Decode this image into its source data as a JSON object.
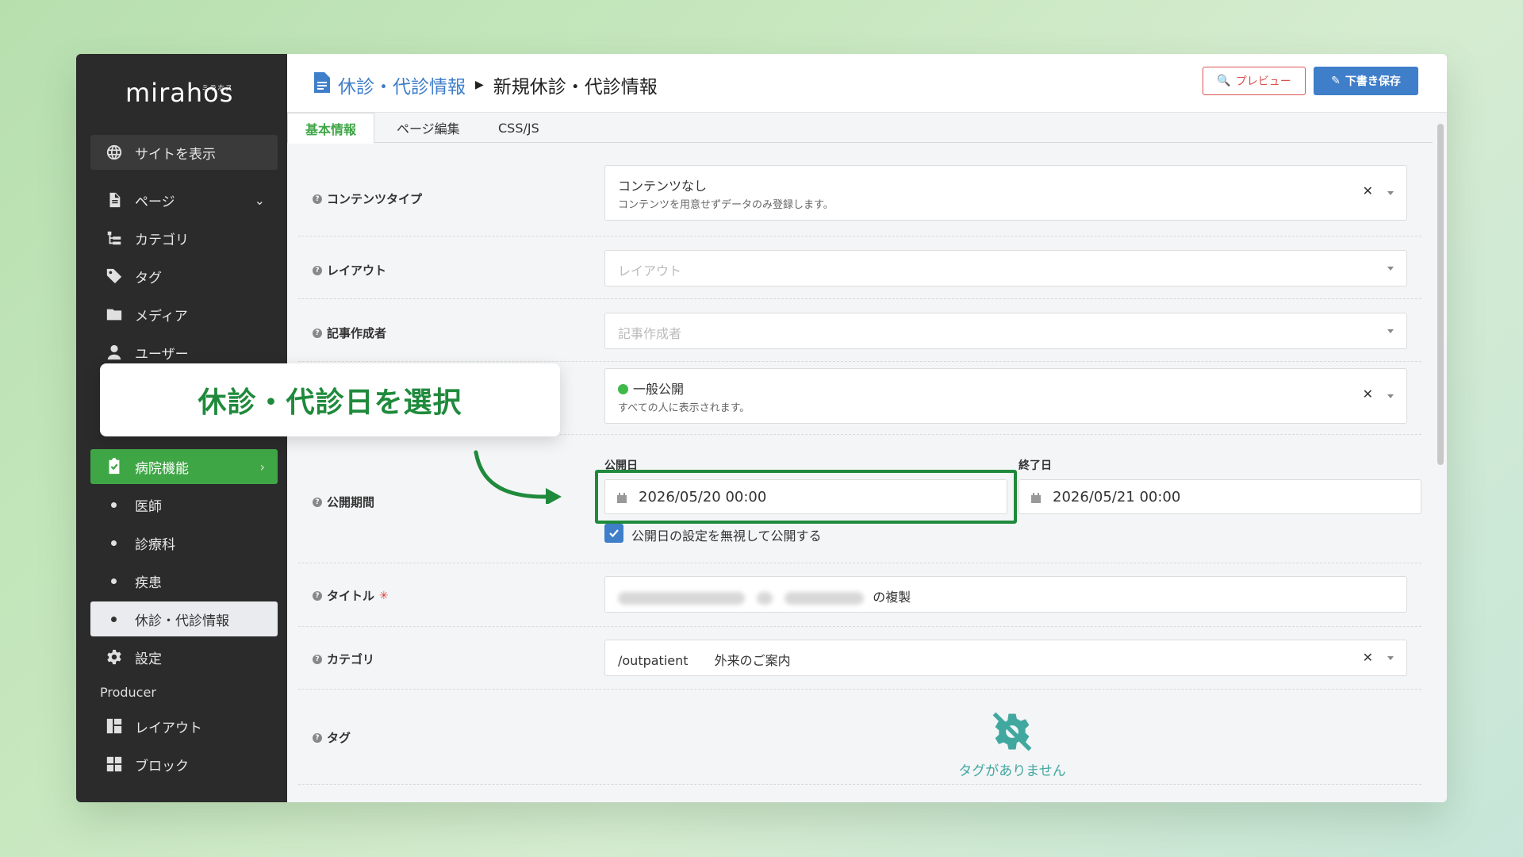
{
  "brand": {
    "logo": "mirahos",
    "logo_kana": "ミラホス"
  },
  "sidebar": {
    "site_link": "サイトを表示",
    "items": [
      {
        "label": "ページ",
        "icon": "page-icon"
      },
      {
        "label": "カテゴリ",
        "icon": "category-icon"
      },
      {
        "label": "タグ",
        "icon": "tag-icon"
      },
      {
        "label": "メディア",
        "icon": "folder-icon"
      },
      {
        "label": "ユーザー",
        "icon": "user-icon"
      }
    ],
    "hospital": {
      "label": "病院機能",
      "icon": "check-clipboard-icon"
    },
    "sub_items": [
      "医師",
      "診療科",
      "疾患",
      "休診・代診情報"
    ],
    "settings": "設定",
    "producer_section": "Producer",
    "producer_items": [
      "レイアウト",
      "ブロック"
    ]
  },
  "header": {
    "breadcrumb_parent": "休診・代診情報",
    "breadcrumb_current": "新規休診・代診情報",
    "preview_label": "プレビュー",
    "save_label": "下書き保存"
  },
  "tabs": [
    "基本情報",
    "ページ編集",
    "CSS/JS"
  ],
  "form": {
    "content_type": {
      "label": "コンテンツタイプ",
      "value": "コンテンツなし",
      "description": "コンテンツを用意せずデータのみ登録します。"
    },
    "layout": {
      "label": "レイアウト",
      "placeholder": "レイアウト"
    },
    "author": {
      "label": "記事作成者",
      "placeholder": "記事作成者"
    },
    "visibility": {
      "value": "一般公開",
      "description": "すべての人に表示されます。",
      "status_color": "#3fb94a"
    },
    "period": {
      "label": "公開期間",
      "start_label": "公開日",
      "start_value": "2026/05/20 00:00",
      "end_label": "終了日",
      "end_value": "2026/05/21 00:00",
      "ignore_checkbox_label": "公開日の設定を無視して公開する",
      "ignore_checked": true
    },
    "title": {
      "label": "タイトル",
      "required_mark": "✳",
      "suffix": "の複製"
    },
    "category": {
      "label": "カテゴリ",
      "slug": "/outpatient",
      "name": "外来のご案内"
    },
    "tags": {
      "label": "タグ",
      "empty_message": "タグがありません"
    }
  },
  "callout": {
    "text": "休診・代診日を選択",
    "color": "#1f8a3c"
  },
  "colors": {
    "accent_green": "#3fa646",
    "link_blue": "#3f7ec9",
    "danger": "#d9534f",
    "teal": "#41a8a0"
  }
}
